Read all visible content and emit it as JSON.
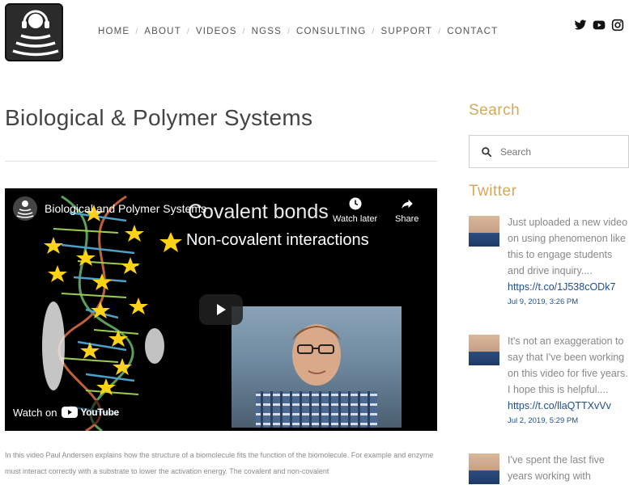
{
  "nav": {
    "items": [
      {
        "label": "HOME"
      },
      {
        "label": "ABOUT"
      },
      {
        "label": "VIDEOS"
      },
      {
        "label": "NGSS"
      },
      {
        "label": "CONSULTING"
      },
      {
        "label": "SUPPORT"
      },
      {
        "label": "CONTACT"
      }
    ]
  },
  "social": [
    "twitter-icon",
    "youtube-icon",
    "instagram-icon"
  ],
  "page": {
    "title": "Biological & Polymer Systems"
  },
  "video": {
    "title": "Biological and Polymer Systems",
    "watch_later": "Watch later",
    "share": "Share",
    "slide_line1": "Covalent bonds",
    "slide_line2": "Non-covalent interactions",
    "watch_on": "Watch on",
    "youtube": "YouTube"
  },
  "description": "In this video Paul Andersen explains how the structure of a biomolecule fits the function of the biomolecule. For example and enzyme must interact correctly with a substrate to lower the activation energy. The covalent and non-covalent",
  "sidebar": {
    "search_heading": "Search",
    "search_placeholder": "Search",
    "twitter_heading": "Twitter",
    "tweets": [
      {
        "text": "Just uploaded a new video on using phenomenon like this to engage students and drive inquiry....",
        "link": "https://t.co/1J538cODk7",
        "date": "Jul 9, 2019, 3:26 PM"
      },
      {
        "text": "It's not an exaggeration to say that I've been working on this video for five years. I hope this is helpful....",
        "link": "https://t.co/llaQTTXvVv",
        "date": "Jul 2, 2019, 5:29 PM"
      },
      {
        "text": "I've spent the last five years working with",
        "link": "",
        "date": ""
      }
    ]
  },
  "colors": {
    "accent": "#d4a85a",
    "link": "#1f4e8c"
  }
}
